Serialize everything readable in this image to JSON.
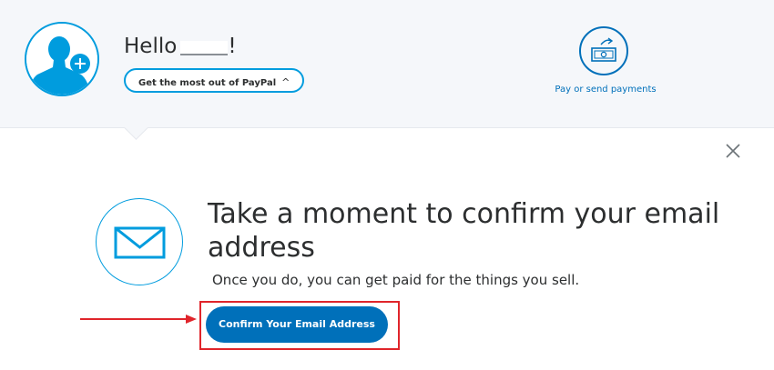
{
  "header": {
    "greeting": "Hello",
    "greeting_suffix": "!",
    "promo_button_label": "Get the most out of PayPal",
    "promo_chevron": "^",
    "pay_action_label": "Pay or send payments",
    "avatar_icon": "user-add-icon",
    "pay_icon": "cash-send-icon"
  },
  "banner": {
    "headline": "Take a moment to confirm your email address",
    "subtext": "Once you do, you can get paid for the things you sell.",
    "confirm_button_label": "Confirm Your Email Address",
    "envelope_icon": "envelope-icon",
    "close_icon": "close-icon"
  },
  "annotation": {
    "highlight_color": "#e0252b",
    "arrow_color": "#e0252b"
  },
  "colors": {
    "brand_blue": "#0070ba",
    "light_blue": "#009cde",
    "header_bg": "#f5f7fa",
    "text": "#2c2e2f"
  }
}
